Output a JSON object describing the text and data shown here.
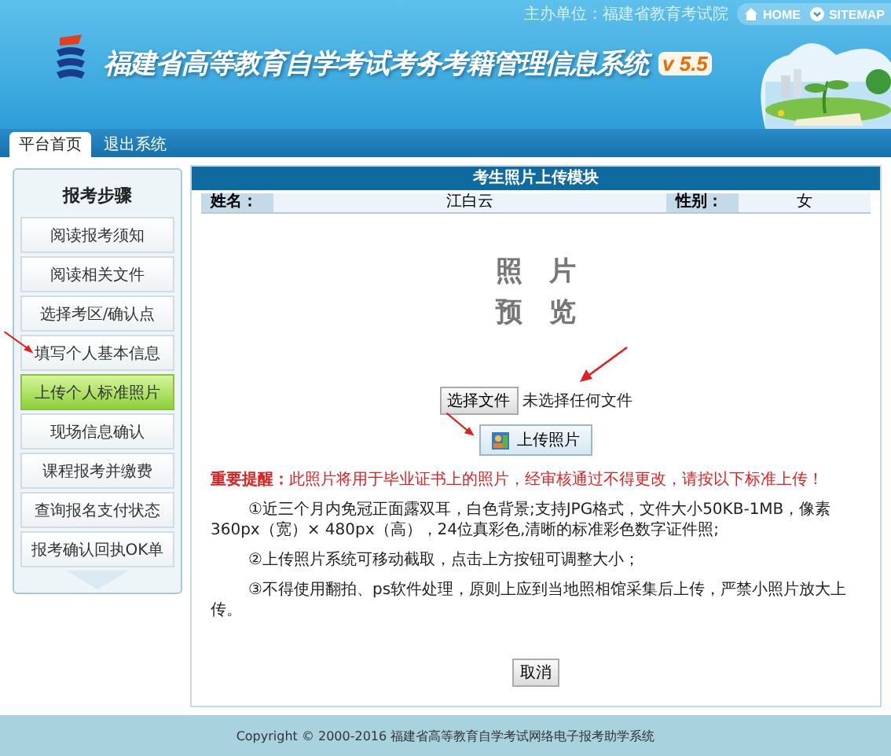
{
  "header": {
    "sponsor": "主办单位：福建省教育考试院",
    "links": [
      {
        "label": "HOME",
        "kind": "home"
      },
      {
        "label": "SITEMAP",
        "kind": "sitemap"
      }
    ],
    "title": "福建省高等教育自学考试考务考籍管理信息系统",
    "version": "v 5.5"
  },
  "tabs": [
    {
      "label": "平台首页",
      "selected": true
    },
    {
      "label": "退出系统",
      "selected": false
    }
  ],
  "sidebar": {
    "title": "报考步骤",
    "items": [
      {
        "label": "阅读报考须知",
        "selected": false
      },
      {
        "label": "阅读相关文件",
        "selected": false
      },
      {
        "label": "选择考区/确认点",
        "selected": false
      },
      {
        "label": "填写个人基本信息",
        "selected": false
      },
      {
        "label": "上传个人标准照片",
        "selected": true
      },
      {
        "label": "现场信息确认",
        "selected": false
      },
      {
        "label": "课程报考并缴费",
        "selected": false
      },
      {
        "label": "查询报名支付状态",
        "selected": false
      },
      {
        "label": "报考确认回执OK单",
        "selected": false
      }
    ]
  },
  "panel": {
    "title": "考生照片上传模块",
    "info": [
      {
        "label": "姓名：",
        "value": "江白云"
      },
      {
        "label": "性别：",
        "value": "女"
      }
    ],
    "preview": [
      "照　片",
      "预　览"
    ],
    "file_button": "选择文件",
    "file_status": "未选择任何文件",
    "upload_button": "上传照片",
    "warning_label": "重要提醒：",
    "warning": "此照片将用于毕业证书上的照片，经审核通过不得更改，请按以下标准上传！",
    "rules": [
      "①近三个月内免冠正面露双耳，白色背景;支持JPG格式，文件大小50KB-1MB，像素360px（宽）× 480px（高），24位真彩色,清晰的标准彩色数字证件照;",
      "②上传照片系统可移动截取，点击上方按钮可调整大小；",
      "③不得使用翻拍、ps软件处理，原则上应到当地照相馆采集后上传，严禁小照片放大上传。"
    ],
    "cancel_button": "取消"
  },
  "footer": "Copyright © 2000-2016 福建省高等教育自学考试网络电子报考助学系统"
}
